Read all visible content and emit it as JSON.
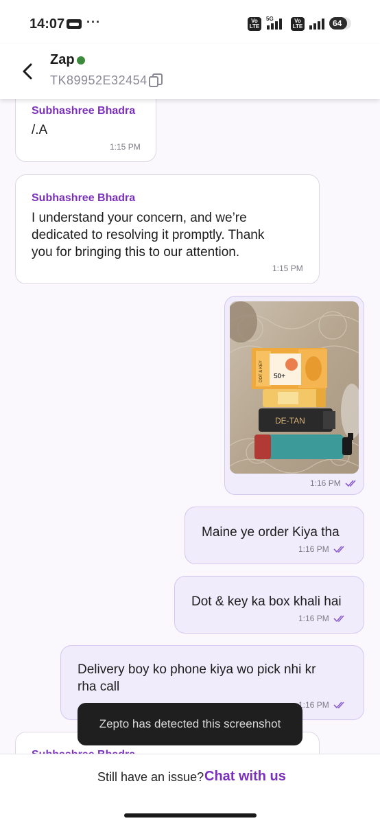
{
  "status_bar": {
    "time": "14:07",
    "dots": "···",
    "volte_1": "Vo LTE",
    "net_5g": "5G",
    "volte_2": "Vo LTE",
    "battery_level": "64",
    "icons": [
      "call-icon",
      "signal-icon",
      "battery-icon"
    ]
  },
  "header": {
    "title": "Zap",
    "status": "online",
    "ticket_id": "TK89952E32454",
    "icons": [
      "back-arrow-icon",
      "copy-icon"
    ]
  },
  "messages": [
    {
      "type": "incoming",
      "sender": "Subhashree Bhadra",
      "text": "/.A",
      "time": "1:15 PM"
    },
    {
      "type": "incoming",
      "sender": "Subhashree Bhadra",
      "text": "I understand your concern, and we’re dedicated to resolving it promptly. Thank you for bringing this to our attention.",
      "lines": [
        "I understand your concern, and we’re",
        "dedicated to resolving it promptly. Thank",
        "you for bringing this to our attention."
      ],
      "time": "1:15 PM"
    },
    {
      "type": "outgoing",
      "kind": "image",
      "time": "1:16 PM",
      "read": true
    },
    {
      "type": "outgoing",
      "text": "Maine ye order Kiya tha",
      "time": "1:16 PM",
      "read": true
    },
    {
      "type": "outgoing",
      "text": "Dot & key ka box khali hai",
      "time": "1:16 PM",
      "read": true
    },
    {
      "type": "outgoing",
      "text": "Delivery boy ko phone kiya wo pick nhi kr rha call",
      "lines": [
        "Delivery boy ko phone kiya wo pick nhi kr",
        "rha call"
      ],
      "time": "1:16 PM",
      "read": true
    },
    {
      "type": "incoming",
      "sender": "Subhashree Bhadra",
      "partial": true
    }
  ],
  "photo_labels": {
    "brand": "DOT & KEY",
    "spf": "50+",
    "detan": "DE-TAN"
  },
  "toast": {
    "text": "Zepto has detected this screenshot"
  },
  "footer": {
    "question": "Still have an issue?",
    "link": "Chat with us"
  },
  "colors": {
    "accent": "#7b2fbe",
    "outgoing_bubble": "#f0ecfb",
    "incoming_bubble": "#ffffff",
    "online": "#3c8a3c"
  }
}
